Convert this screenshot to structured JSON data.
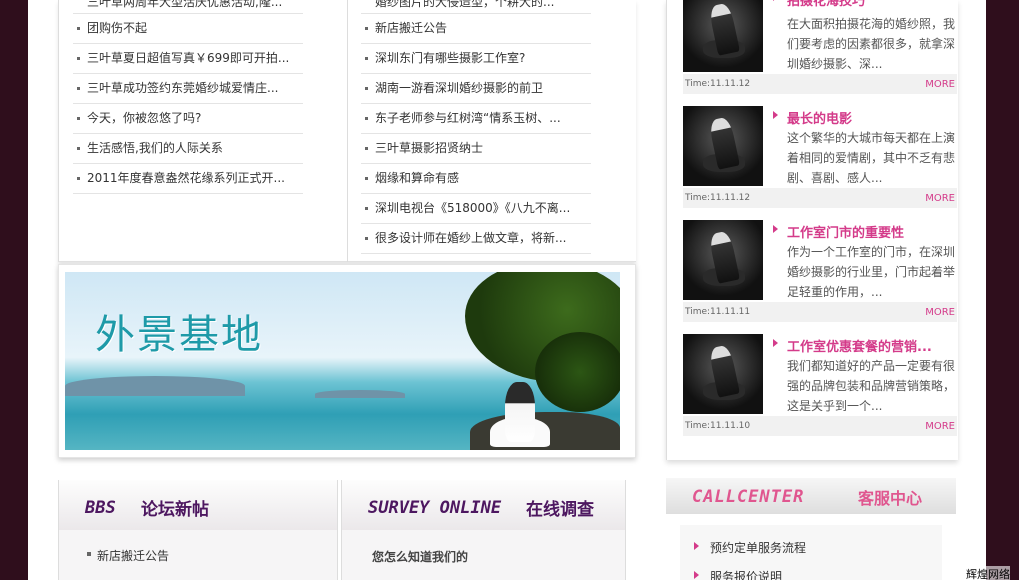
{
  "news": {
    "left": [
      "三叶草两周年大型活庆优惠活动,隆...",
      "团购伤不起",
      "三叶草夏日超值写真￥699即可开拍...",
      "三叶草成功签约东莞婚纱城爱情庄...",
      "今天，你被忽悠了吗?",
      "生活感悟,我们的人际关系",
      "2011年度春意盎然花缘系列正式开..."
    ],
    "right": [
      "婚纱图片的大侵造型，个耕大的...",
      "新店搬迁公告",
      "深圳东门有哪些摄影工作室?",
      "湖南一游看深圳婚纱摄影的前卫",
      "东子老师参与红树湾“情系玉树、...",
      "三叶草摄影招贤纳士",
      "烟缘和算命有感",
      "深圳电视台《518000》《八九不离...",
      "很多设计师在婚纱上做文章，将新..."
    ]
  },
  "banner": {
    "title": "外景基地"
  },
  "forum": {
    "en": "BBS",
    "cn": "论坛新帖",
    "items": [
      "新店搬迁公告"
    ]
  },
  "survey": {
    "en": "SURVEY ONLINE",
    "cn": "在线调查",
    "question": "您怎么知道我们的"
  },
  "articles": [
    {
      "title": "拍摄花海技巧",
      "summary": "在大面积拍摄花海的婚纱照，我们要考虑的因素都很多，就拿深圳婚纱摄影、深...",
      "time": "Time:11.11.12",
      "more": "MORE"
    },
    {
      "title": "最长的电影",
      "summary": "这个繁华的大城市每天都在上演着相同的爱情剧，其中不乏有悲剧、喜剧、感人...",
      "time": "Time:11.11.12",
      "more": "MORE"
    },
    {
      "title": "工作室门市的重要性",
      "summary": "作为一个工作室的门市，在深圳婚纱摄影的行业里，门市起着举足轻重的作用，...",
      "time": "Time:11.11.11",
      "more": "MORE"
    },
    {
      "title": "工作室优惠套餐的营销...",
      "summary": "我们都知道好的产品一定要有很强的品牌包装和品牌营销策略，这是关乎到一个...",
      "time": "Time:11.11.10",
      "more": "MORE"
    }
  ],
  "callcenter": {
    "en": "CALLCENTER",
    "cn": "客服中心",
    "items": [
      "预约定单服务流程",
      "服务报价说明"
    ]
  },
  "watermark": "辉煌网络",
  "colors": {
    "accent": "#d43b8a",
    "heading": "#4d1760",
    "background": "#2f0e1c"
  }
}
